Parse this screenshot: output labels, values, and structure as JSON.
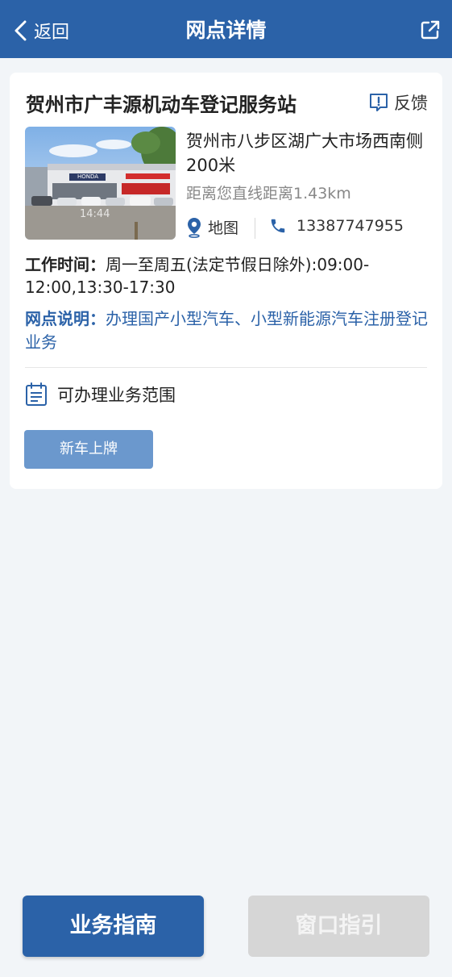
{
  "header": {
    "back_label": "返回",
    "title": "网点详情",
    "share_icon": "share-external-icon",
    "background": "#2b62a8"
  },
  "station": {
    "name": "贺州市广丰源机动车登记服务站",
    "feedback_label": "反馈",
    "address": "贺州市八步区湖广大市场西南侧200米",
    "distance": "距离您直线距离1.43km",
    "map_label": "地图",
    "phone": "13387747955",
    "hours_label": "工作时间：",
    "hours_value": "周一至周五(法定节假日除外):09:00-12:00,13:30-17:30",
    "desc_label": "网点说明：",
    "desc_value": "办理国产小型汽车、小型新能源汽车注册登记业务",
    "photo_caption": "14:44",
    "photo_sign": "HONDA"
  },
  "scope": {
    "label": "可办理业务范围",
    "tags": [
      "新车上牌"
    ]
  },
  "bottom": {
    "guide_label": "业务指南",
    "window_label": "窗口指引"
  },
  "colors": {
    "accent": "#2b62a8",
    "tag": "#6b98cd",
    "disabled": "#d6d6d6"
  }
}
